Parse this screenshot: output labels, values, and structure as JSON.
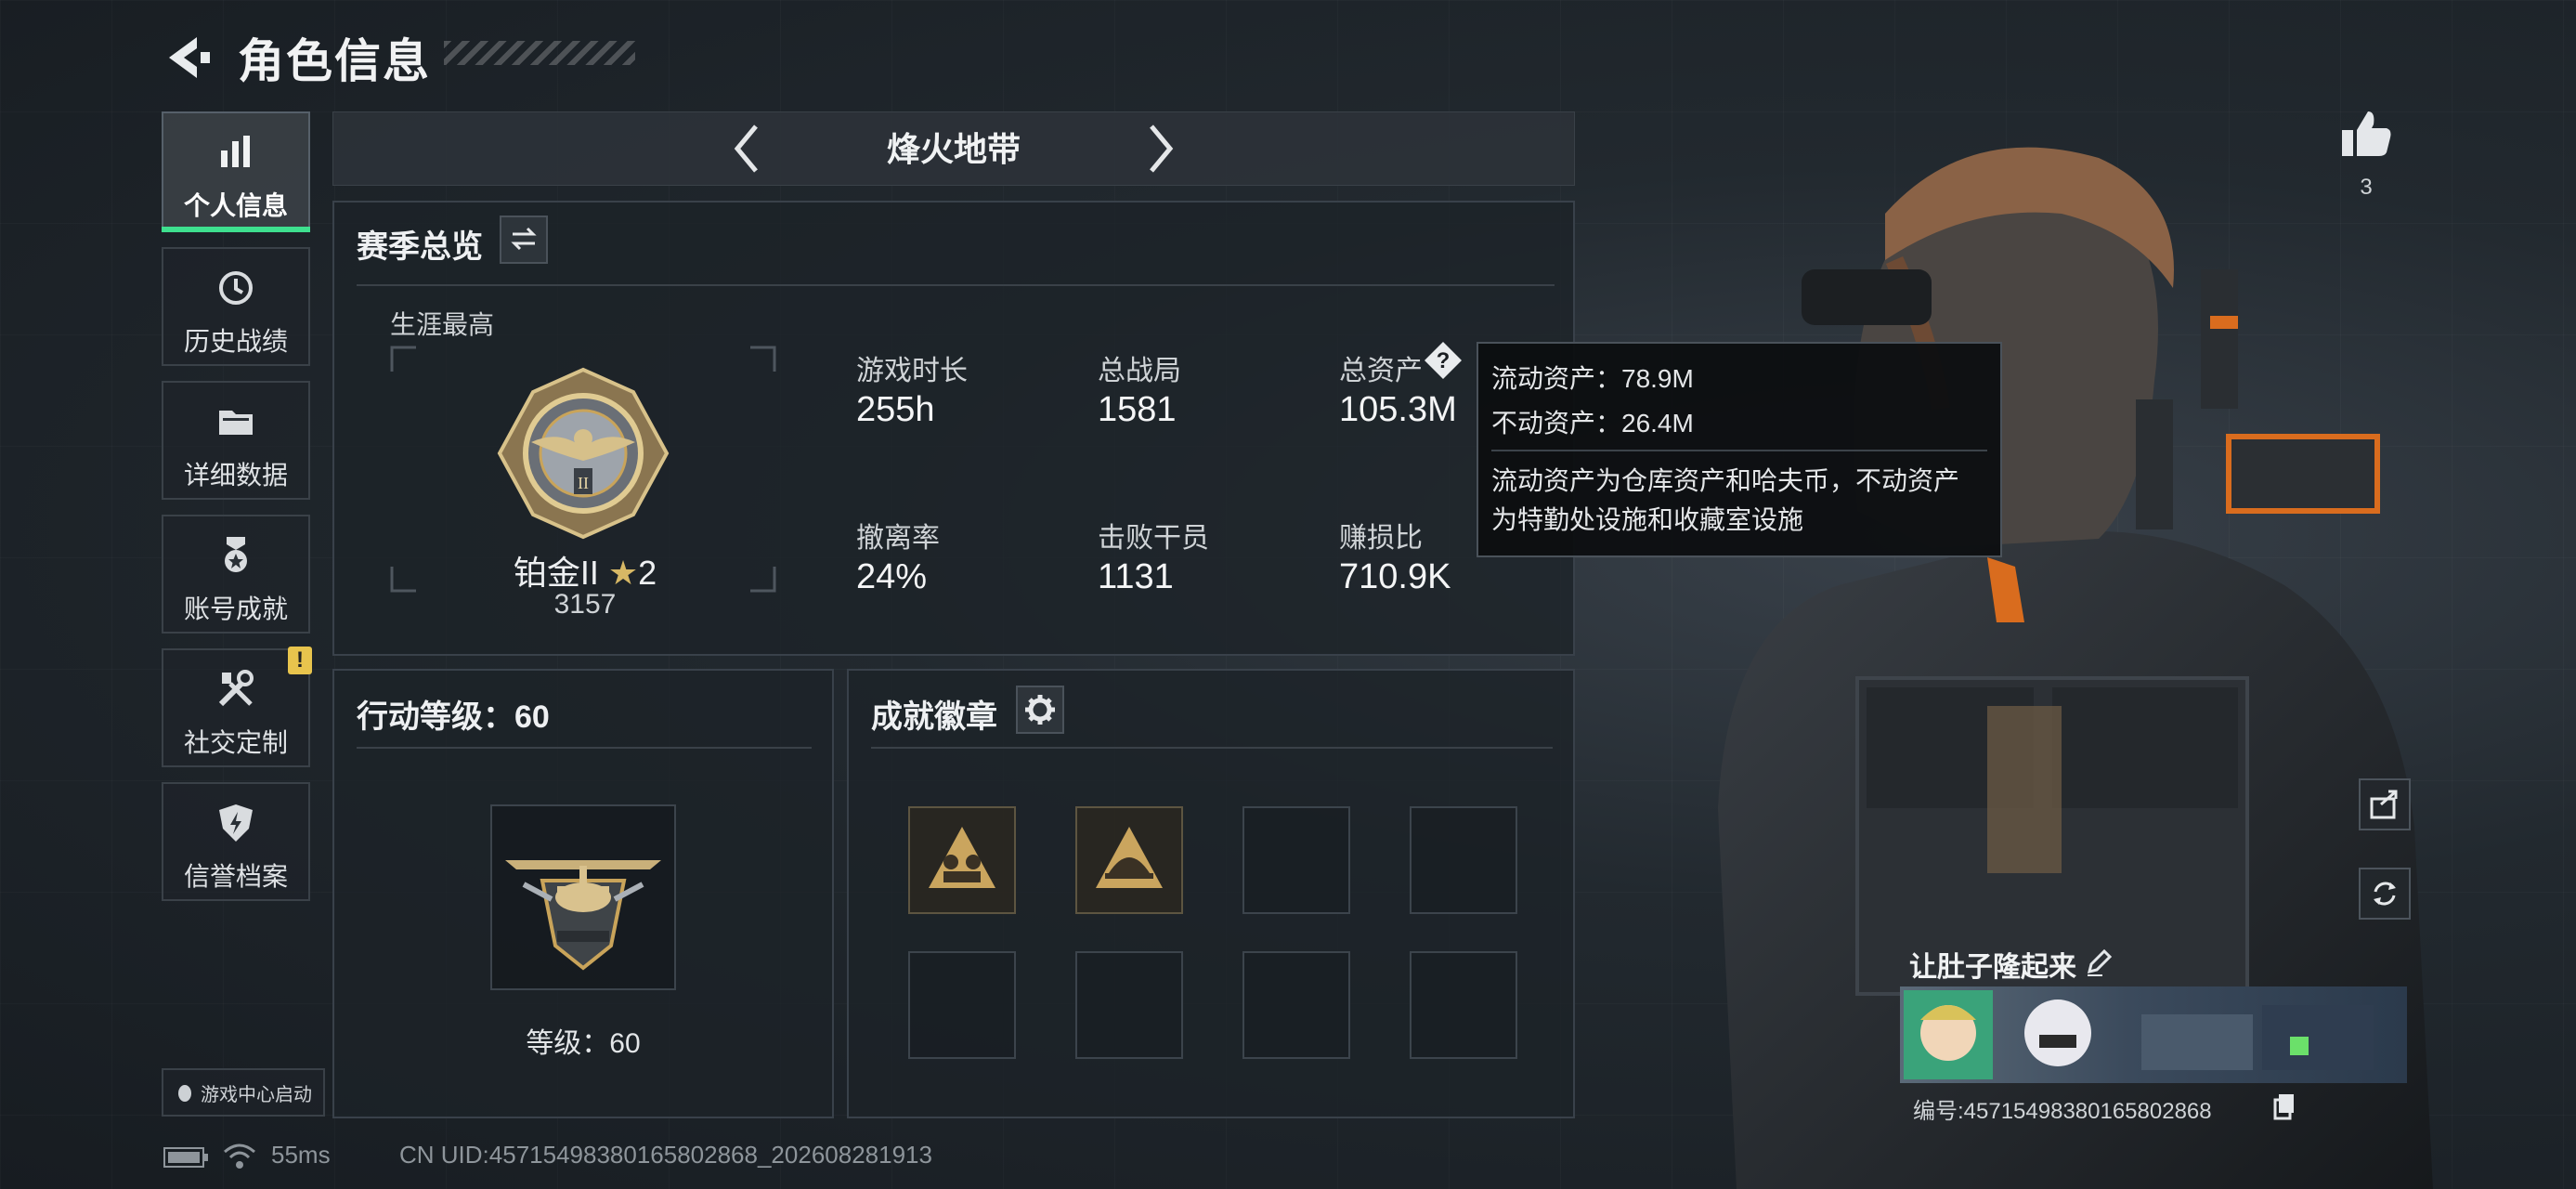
{
  "header": {
    "title": "角色信息",
    "back_icon": "back-arrow-icon"
  },
  "sidebar": {
    "items": [
      {
        "label": "个人信息",
        "icon": "bar-chart-icon",
        "active": true
      },
      {
        "label": "历史战绩",
        "icon": "history-clock-icon"
      },
      {
        "label": "详细数据",
        "icon": "folder-icon"
      },
      {
        "label": "账号成就",
        "icon": "medal-icon"
      },
      {
        "label": "社交定制",
        "icon": "tools-icon",
        "badge": "!"
      },
      {
        "label": "信誉档案",
        "icon": "shield-bolt-icon"
      }
    ],
    "game_center": "游戏中心启动"
  },
  "mode": {
    "label": "烽火地带"
  },
  "season": {
    "title": "赛季总览",
    "career_label": "生涯最高",
    "rank_name": "铂金II",
    "rank_stars": "2",
    "rank_points": "3157",
    "stats": [
      {
        "label": "游戏时长",
        "value": "255h"
      },
      {
        "label": "总战局",
        "value": "1581"
      },
      {
        "label": "总资产",
        "value": "105.3M"
      },
      {
        "label": "撤离率",
        "value": "24%"
      },
      {
        "label": "击败干员",
        "value": "1131"
      },
      {
        "label": "赚损比",
        "value": "710.9K"
      }
    ]
  },
  "tooltip": {
    "liquid": "流动资产：78.9M",
    "fixed": "不动资产：26.4M",
    "desc_line1": "流动资产为仓库资产和哈夫币，不动资产",
    "desc_line2": "为特勤处设施和收藏室设施"
  },
  "action_level": {
    "title": "行动等级：60",
    "level_text": "等级：60"
  },
  "achievements": {
    "title": "成就徽章",
    "filled_slots": 2,
    "total_slots": 8
  },
  "profile": {
    "likes": "3",
    "nickname": "让肚子隆起来",
    "id_text": "编号:4571549838016580286​8"
  },
  "status_bar": {
    "ping": "55ms",
    "uid": "CN UID:45715498380165802868_202608281913"
  },
  "colors": {
    "accent_green": "#3ee08f",
    "warning_yellow": "#e8c44d",
    "gold": "#c9a45a"
  }
}
